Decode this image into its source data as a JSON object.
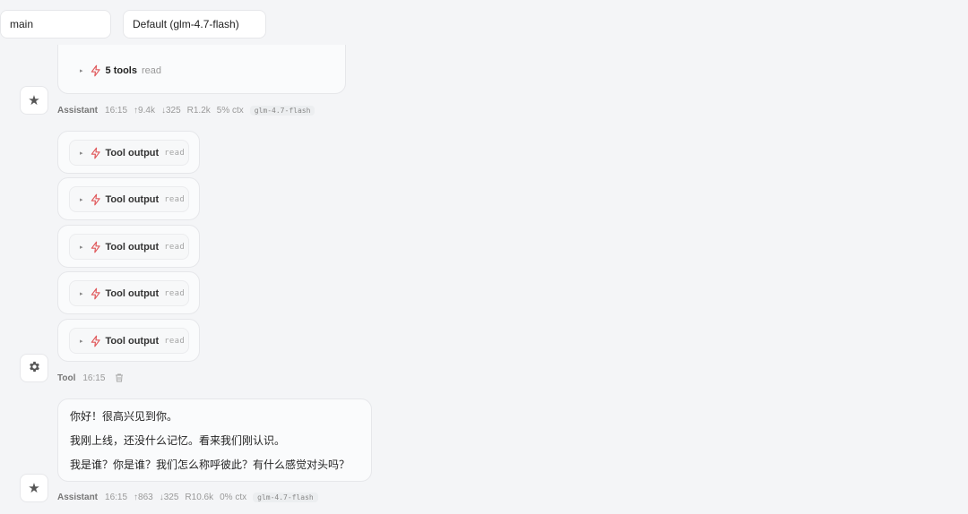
{
  "selectors": {
    "branch": "main",
    "model": "Default (glm-4.7-flash)"
  },
  "tool_summary": {
    "label": "5 tools",
    "kind": "read"
  },
  "assistant_meta_1": {
    "who": "Assistant",
    "time": "16:15",
    "tokens_in": "↑9.4k",
    "tokens_out": "↓325",
    "cache": "R1.2k",
    "ctx": "5% ctx",
    "model": "glm-4.7-flash"
  },
  "tool_outputs": [
    {
      "label": "Tool output",
      "kind": "read"
    },
    {
      "label": "Tool output",
      "kind": "read"
    },
    {
      "label": "Tool output",
      "kind": "read"
    },
    {
      "label": "Tool output",
      "kind": "read"
    },
    {
      "label": "Tool output",
      "kind": "read"
    }
  ],
  "tool_meta": {
    "who": "Tool",
    "time": "16:15"
  },
  "message": {
    "lines": [
      "你好！很高兴见到你。",
      "我刚上线，还没什么记忆。看来我们刚认识。",
      "我是谁？你是谁？我们怎么称呼彼此？有什么感觉对头吗？"
    ]
  },
  "assistant_meta_2": {
    "who": "Assistant",
    "time": "16:15",
    "tokens_in": "↑863",
    "tokens_out": "↓325",
    "cache": "R10.6k",
    "ctx": "0% ctx",
    "model": "glm-4.7-flash"
  },
  "colors": {
    "accent_bolt": "#e0585b",
    "background": "#f4f5f7"
  },
  "icons": {
    "assistant_avatar": "star-icon",
    "tool_avatar": "gear-icon",
    "tool_marker": "lightning-icon",
    "delete": "trash-icon"
  }
}
